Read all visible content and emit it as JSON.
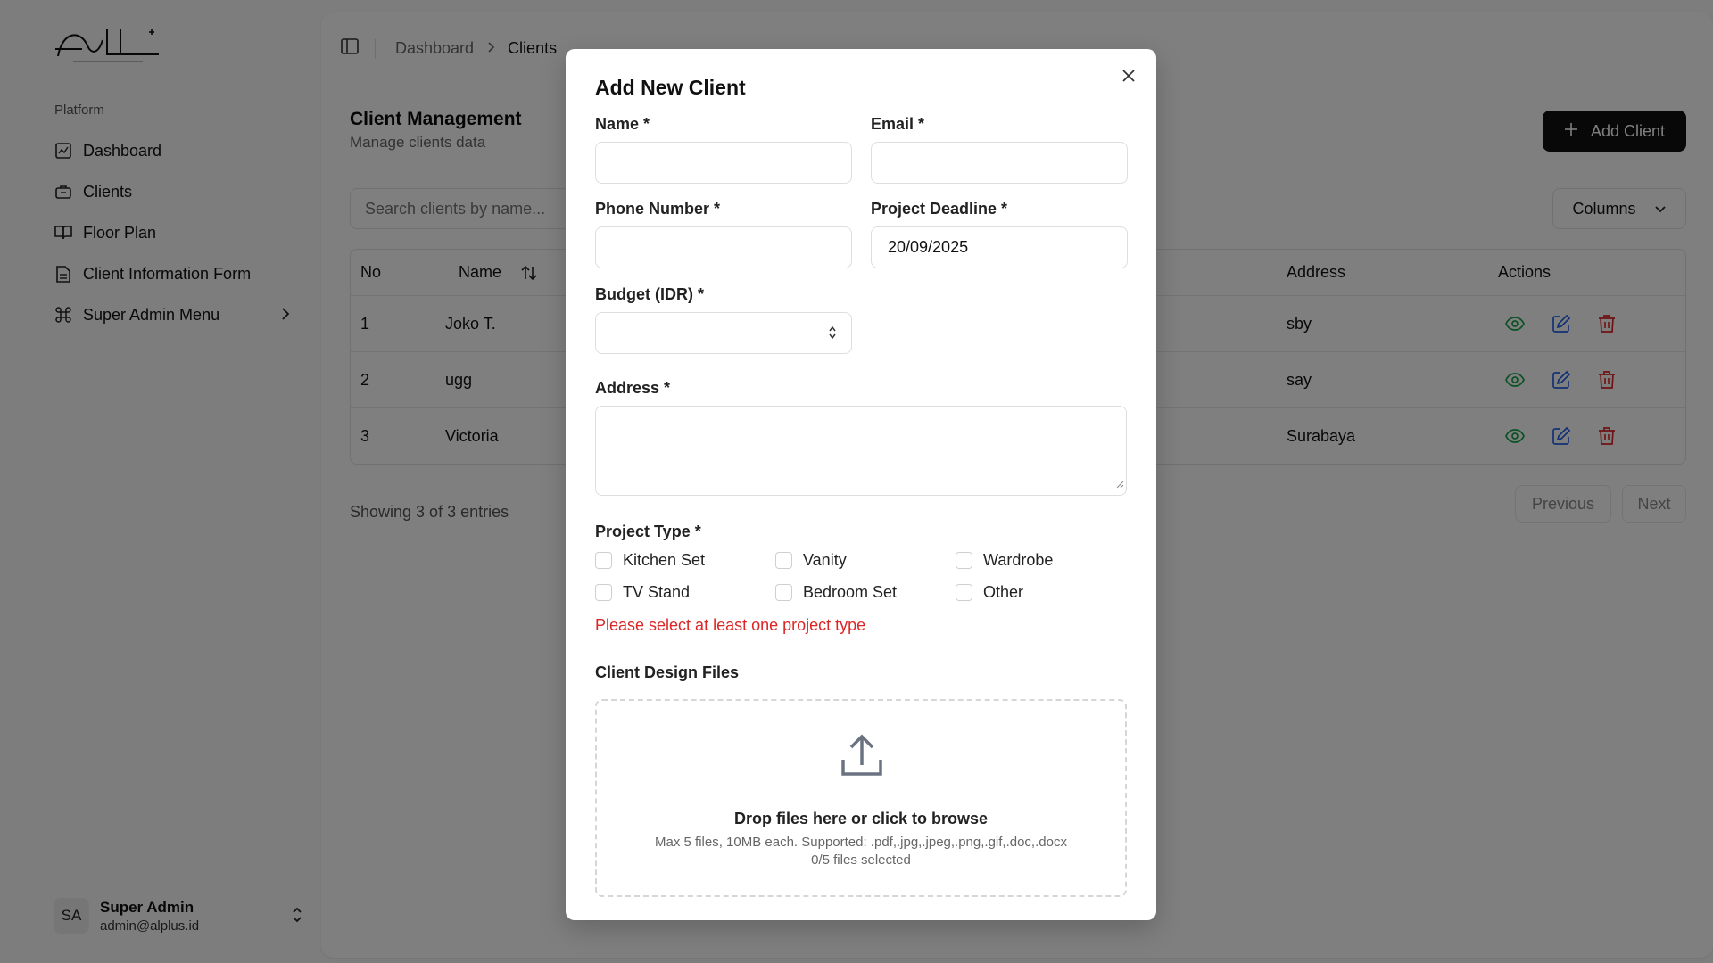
{
  "sidebar": {
    "group_label": "Platform",
    "items": [
      {
        "label": "Dashboard"
      },
      {
        "label": "Clients"
      },
      {
        "label": "Floor Plan"
      },
      {
        "label": "Client Information Form"
      },
      {
        "label": "Super Admin Menu"
      }
    ],
    "user": {
      "initials": "SA",
      "name": "Super Admin",
      "email": "admin@alplus.id"
    }
  },
  "breadcrumb": {
    "parent": "Dashboard",
    "current": "Clients"
  },
  "page": {
    "title": "Client Management",
    "subtitle": "Manage clients data",
    "add_button": "Add Client",
    "search_placeholder": "Search clients by name...",
    "columns_button": "Columns"
  },
  "table": {
    "headers": {
      "no": "No",
      "name": "Name",
      "address": "Address",
      "actions": "Actions"
    },
    "rows": [
      {
        "no": "1",
        "name": "Joko T.",
        "address": "sby"
      },
      {
        "no": "2",
        "name": "ugg",
        "address": "say"
      },
      {
        "no": "3",
        "name": "Victoria",
        "address": "Surabaya"
      }
    ],
    "info": "Showing 3 of 3 entries",
    "previous": "Previous",
    "next": "Next"
  },
  "modal": {
    "title": "Add New Client",
    "labels": {
      "name": "Name *",
      "email": "Email *",
      "phone": "Phone Number *",
      "deadline": "Project Deadline *",
      "budget": "Budget (IDR) *",
      "address": "Address *",
      "project_type": "Project Type *",
      "files": "Client Design Files"
    },
    "values": {
      "deadline": "20/09/2025"
    },
    "project_types": [
      "Kitchen Set",
      "Vanity",
      "Wardrobe",
      "TV Stand",
      "Bedroom Set",
      "Other"
    ],
    "error": "Please select at least one project type",
    "upload": {
      "title": "Drop files here or click to browse",
      "hint": "Max 5 files, 10MB each. Supported: .pdf,.jpg,.jpeg,.png,.gif,.doc,.docx",
      "count": "0/5 files selected"
    }
  },
  "colors": {
    "accent": "#111111",
    "error": "#dc2626",
    "view_icon": "#16a34a",
    "edit_icon": "#2563eb",
    "delete_icon": "#dc2626"
  }
}
